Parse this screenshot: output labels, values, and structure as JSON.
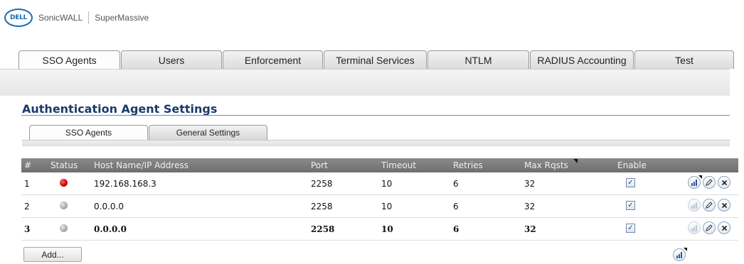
{
  "header": {
    "brand_logo": "DELL",
    "product": "SonicWALL",
    "model": "SuperMassive"
  },
  "top_tabs": [
    {
      "label": "SSO Agents",
      "active": true
    },
    {
      "label": "Users",
      "active": false
    },
    {
      "label": "Enforcement",
      "active": false
    },
    {
      "label": "Terminal Services",
      "active": false
    },
    {
      "label": "NTLM",
      "active": false
    },
    {
      "label": "RADIUS Accounting",
      "active": false
    },
    {
      "label": "Test",
      "active": false
    }
  ],
  "section": {
    "title": "Authentication Agent Settings"
  },
  "sub_tabs": [
    {
      "label": "SSO Agents",
      "active": true
    },
    {
      "label": "General Settings",
      "active": false
    }
  ],
  "table": {
    "columns": [
      "#",
      "Status",
      "Host Name/IP Address",
      "Port",
      "Timeout",
      "Retries",
      "Max Rqsts",
      "Enable"
    ],
    "rows": [
      {
        "num": "1",
        "status": "red",
        "host": "192.168.168.3",
        "port": "2258",
        "timeout": "10",
        "retries": "6",
        "max": "32",
        "enabled": true,
        "bold": false,
        "stats_active": true
      },
      {
        "num": "2",
        "status": "grey",
        "host": "0.0.0.0",
        "port": "2258",
        "timeout": "10",
        "retries": "6",
        "max": "32",
        "enabled": true,
        "bold": false,
        "stats_active": false
      },
      {
        "num": "3",
        "status": "grey",
        "host": "0.0.0.0",
        "port": "2258",
        "timeout": "10",
        "retries": "6",
        "max": "32",
        "enabled": true,
        "bold": true,
        "stats_active": false
      }
    ]
  },
  "actions": {
    "add_label": "Add..."
  },
  "colors": {
    "accent": "#1b3a6b",
    "header_bg": "#7a7a7a",
    "status_red": "#c80000",
    "status_grey": "#a9a9a9"
  },
  "icons": [
    "stats-icon",
    "edit-icon",
    "delete-icon",
    "checkbox-checked-icon"
  ]
}
